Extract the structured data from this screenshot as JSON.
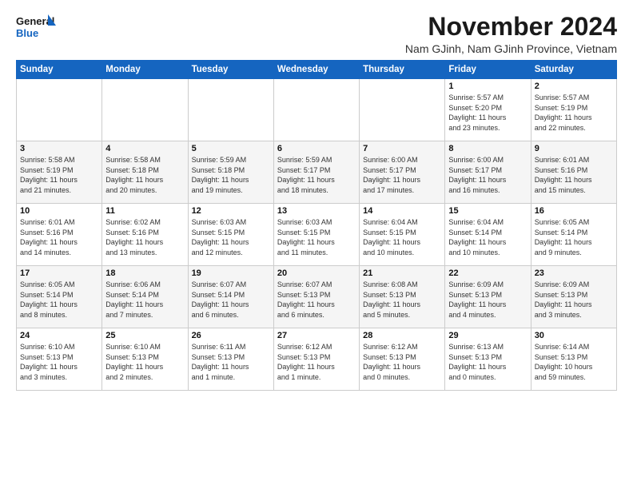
{
  "logo": {
    "general": "General",
    "blue": "Blue"
  },
  "header": {
    "month_title": "November 2024",
    "subtitle": "Nam GJinh, Nam GJinh Province, Vietnam"
  },
  "days_of_week": [
    "Sunday",
    "Monday",
    "Tuesday",
    "Wednesday",
    "Thursday",
    "Friday",
    "Saturday"
  ],
  "weeks": [
    [
      {
        "day": "",
        "info": ""
      },
      {
        "day": "",
        "info": ""
      },
      {
        "day": "",
        "info": ""
      },
      {
        "day": "",
        "info": ""
      },
      {
        "day": "",
        "info": ""
      },
      {
        "day": "1",
        "info": "Sunrise: 5:57 AM\nSunset: 5:20 PM\nDaylight: 11 hours\nand 23 minutes."
      },
      {
        "day": "2",
        "info": "Sunrise: 5:57 AM\nSunset: 5:19 PM\nDaylight: 11 hours\nand 22 minutes."
      }
    ],
    [
      {
        "day": "3",
        "info": "Sunrise: 5:58 AM\nSunset: 5:19 PM\nDaylight: 11 hours\nand 21 minutes."
      },
      {
        "day": "4",
        "info": "Sunrise: 5:58 AM\nSunset: 5:18 PM\nDaylight: 11 hours\nand 20 minutes."
      },
      {
        "day": "5",
        "info": "Sunrise: 5:59 AM\nSunset: 5:18 PM\nDaylight: 11 hours\nand 19 minutes."
      },
      {
        "day": "6",
        "info": "Sunrise: 5:59 AM\nSunset: 5:17 PM\nDaylight: 11 hours\nand 18 minutes."
      },
      {
        "day": "7",
        "info": "Sunrise: 6:00 AM\nSunset: 5:17 PM\nDaylight: 11 hours\nand 17 minutes."
      },
      {
        "day": "8",
        "info": "Sunrise: 6:00 AM\nSunset: 5:17 PM\nDaylight: 11 hours\nand 16 minutes."
      },
      {
        "day": "9",
        "info": "Sunrise: 6:01 AM\nSunset: 5:16 PM\nDaylight: 11 hours\nand 15 minutes."
      }
    ],
    [
      {
        "day": "10",
        "info": "Sunrise: 6:01 AM\nSunset: 5:16 PM\nDaylight: 11 hours\nand 14 minutes."
      },
      {
        "day": "11",
        "info": "Sunrise: 6:02 AM\nSunset: 5:16 PM\nDaylight: 11 hours\nand 13 minutes."
      },
      {
        "day": "12",
        "info": "Sunrise: 6:03 AM\nSunset: 5:15 PM\nDaylight: 11 hours\nand 12 minutes."
      },
      {
        "day": "13",
        "info": "Sunrise: 6:03 AM\nSunset: 5:15 PM\nDaylight: 11 hours\nand 11 minutes."
      },
      {
        "day": "14",
        "info": "Sunrise: 6:04 AM\nSunset: 5:15 PM\nDaylight: 11 hours\nand 10 minutes."
      },
      {
        "day": "15",
        "info": "Sunrise: 6:04 AM\nSunset: 5:14 PM\nDaylight: 11 hours\nand 10 minutes."
      },
      {
        "day": "16",
        "info": "Sunrise: 6:05 AM\nSunset: 5:14 PM\nDaylight: 11 hours\nand 9 minutes."
      }
    ],
    [
      {
        "day": "17",
        "info": "Sunrise: 6:05 AM\nSunset: 5:14 PM\nDaylight: 11 hours\nand 8 minutes."
      },
      {
        "day": "18",
        "info": "Sunrise: 6:06 AM\nSunset: 5:14 PM\nDaylight: 11 hours\nand 7 minutes."
      },
      {
        "day": "19",
        "info": "Sunrise: 6:07 AM\nSunset: 5:14 PM\nDaylight: 11 hours\nand 6 minutes."
      },
      {
        "day": "20",
        "info": "Sunrise: 6:07 AM\nSunset: 5:13 PM\nDaylight: 11 hours\nand 6 minutes."
      },
      {
        "day": "21",
        "info": "Sunrise: 6:08 AM\nSunset: 5:13 PM\nDaylight: 11 hours\nand 5 minutes."
      },
      {
        "day": "22",
        "info": "Sunrise: 6:09 AM\nSunset: 5:13 PM\nDaylight: 11 hours\nand 4 minutes."
      },
      {
        "day": "23",
        "info": "Sunrise: 6:09 AM\nSunset: 5:13 PM\nDaylight: 11 hours\nand 3 minutes."
      }
    ],
    [
      {
        "day": "24",
        "info": "Sunrise: 6:10 AM\nSunset: 5:13 PM\nDaylight: 11 hours\nand 3 minutes."
      },
      {
        "day": "25",
        "info": "Sunrise: 6:10 AM\nSunset: 5:13 PM\nDaylight: 11 hours\nand 2 minutes."
      },
      {
        "day": "26",
        "info": "Sunrise: 6:11 AM\nSunset: 5:13 PM\nDaylight: 11 hours\nand 1 minute."
      },
      {
        "day": "27",
        "info": "Sunrise: 6:12 AM\nSunset: 5:13 PM\nDaylight: 11 hours\nand 1 minute."
      },
      {
        "day": "28",
        "info": "Sunrise: 6:12 AM\nSunset: 5:13 PM\nDaylight: 11 hours\nand 0 minutes."
      },
      {
        "day": "29",
        "info": "Sunrise: 6:13 AM\nSunset: 5:13 PM\nDaylight: 11 hours\nand 0 minutes."
      },
      {
        "day": "30",
        "info": "Sunrise: 6:14 AM\nSunset: 5:13 PM\nDaylight: 10 hours\nand 59 minutes."
      }
    ]
  ]
}
